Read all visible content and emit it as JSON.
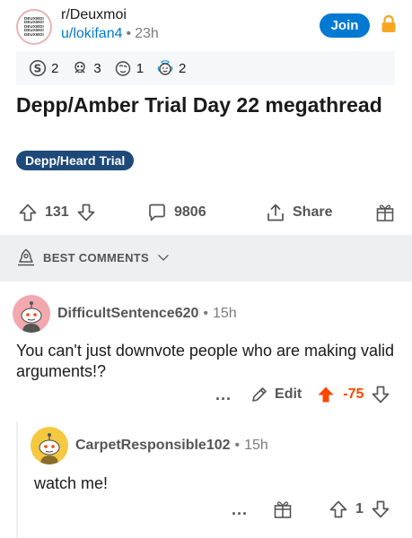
{
  "header": {
    "subreddit": "r/Deuxmoi",
    "subreddit_logo_text": [
      "DEUXMOI",
      "DEUXMOI",
      "DEUXMOI",
      "DEUXMOI",
      "DEUXMOI"
    ],
    "author": "u/lokifan4",
    "separator": "•",
    "age": "23h",
    "join_label": "Join",
    "lock_icon": "lock-icon"
  },
  "awards": [
    {
      "icon": "silver-award-icon",
      "count": "2"
    },
    {
      "icon": "skull-award-icon",
      "count": "3"
    },
    {
      "icon": "facepalm-award-icon",
      "count": "1"
    },
    {
      "icon": "angel-award-icon",
      "count": "2"
    }
  ],
  "post": {
    "title": "Depp/Amber Trial Day 22 megathread",
    "flair": "Depp/Heard Trial"
  },
  "action_bar": {
    "score": "131",
    "comments": "9806",
    "share_label": "Share"
  },
  "sort": {
    "label": "BEST COMMENTS"
  },
  "comments": [
    {
      "author": "DifficultSentence620",
      "separator": "•",
      "age": "15h",
      "body": "You can't just downvote people who are making valid arguments!?",
      "more": "...",
      "edit_label": "Edit",
      "score": "-75",
      "colors": {
        "upvoted": "#ff4500",
        "avatar_bg": "#f3a8ad"
      }
    },
    {
      "author": "CarpetResponsible102",
      "separator": "•",
      "age": "15h",
      "body": "watch me!",
      "more": "...",
      "score": "1",
      "colors": {
        "avatar_bg": "#f5c842"
      }
    }
  ],
  "colors": {
    "accent": "#0079d3",
    "flair_bg": "#1e4a7a",
    "lock": "#f5a623"
  }
}
